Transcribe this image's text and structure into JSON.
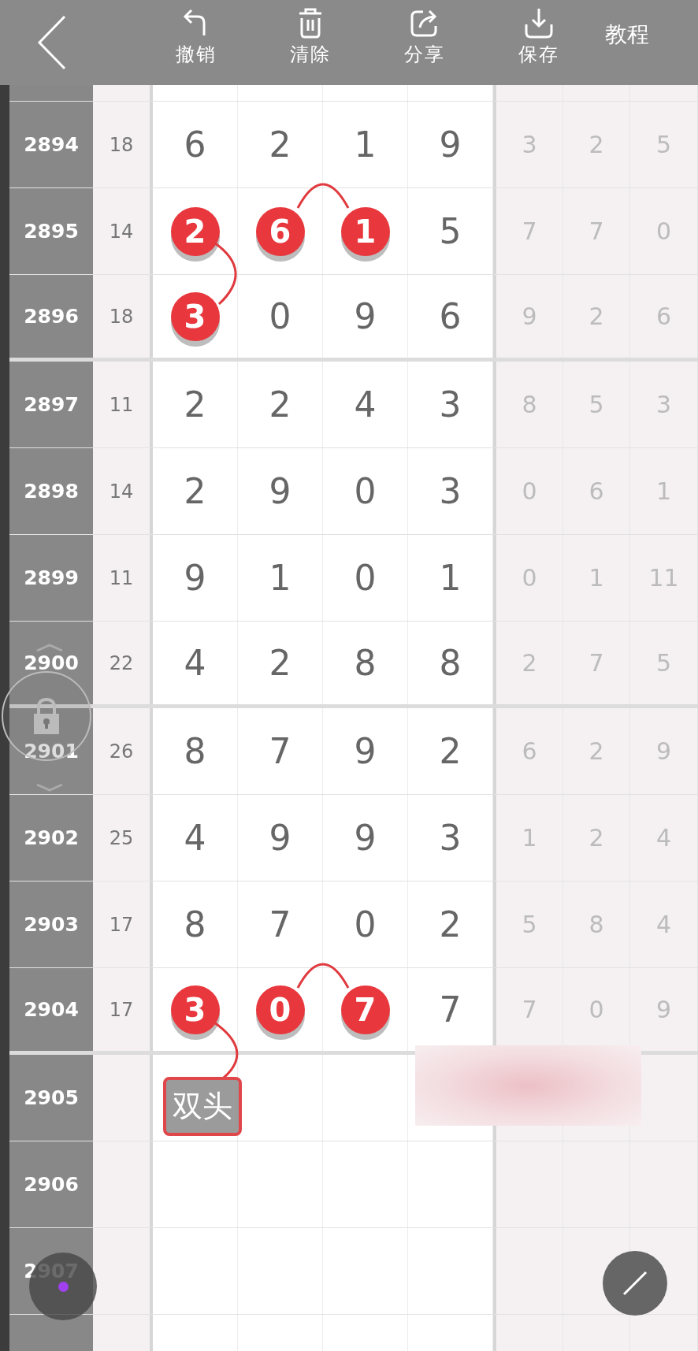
{
  "toolbar": {
    "actions": [
      "撤销",
      "清除",
      "分享",
      "保存"
    ],
    "tutorial": "教程"
  },
  "rows": [
    {
      "issue": "2894",
      "sum": "18",
      "main": [
        {
          "kind": "digit",
          "text": "6"
        },
        {
          "kind": "digit",
          "text": "2"
        },
        {
          "kind": "digit",
          "text": "1"
        },
        {
          "kind": "digit",
          "text": "9"
        }
      ],
      "side": [
        "3",
        "2",
        "5"
      ],
      "group_end": false
    },
    {
      "issue": "2895",
      "sum": "14",
      "main": [
        {
          "kind": "ball",
          "text": "2",
          "arc_to_next": false,
          "drop_line": true
        },
        {
          "kind": "ball",
          "text": "6",
          "arc_to_next": true,
          "drop_line": false
        },
        {
          "kind": "ball",
          "text": "1",
          "arc_to_next": false,
          "drop_line": false
        },
        {
          "kind": "digit",
          "text": "5"
        }
      ],
      "side": [
        "7",
        "7",
        "0"
      ],
      "group_end": false
    },
    {
      "issue": "2896",
      "sum": "18",
      "main": [
        {
          "kind": "ball",
          "text": "3",
          "arc_to_next": false,
          "drop_line": false
        },
        {
          "kind": "digit",
          "text": "0"
        },
        {
          "kind": "digit",
          "text": "9"
        },
        {
          "kind": "digit",
          "text": "6"
        }
      ],
      "side": [
        "9",
        "2",
        "6"
      ],
      "group_end": true
    },
    {
      "issue": "2897",
      "sum": "11",
      "main": [
        {
          "kind": "digit",
          "text": "2"
        },
        {
          "kind": "digit",
          "text": "2"
        },
        {
          "kind": "digit",
          "text": "4"
        },
        {
          "kind": "digit",
          "text": "3"
        }
      ],
      "side": [
        "8",
        "5",
        "3"
      ],
      "group_end": false
    },
    {
      "issue": "2898",
      "sum": "14",
      "main": [
        {
          "kind": "digit",
          "text": "2"
        },
        {
          "kind": "digit",
          "text": "9"
        },
        {
          "kind": "digit",
          "text": "0"
        },
        {
          "kind": "digit",
          "text": "3"
        }
      ],
      "side": [
        "0",
        "6",
        "1"
      ],
      "group_end": false
    },
    {
      "issue": "2899",
      "sum": "11",
      "main": [
        {
          "kind": "digit",
          "text": "9"
        },
        {
          "kind": "digit",
          "text": "1"
        },
        {
          "kind": "digit",
          "text": "0"
        },
        {
          "kind": "digit",
          "text": "1"
        }
      ],
      "side": [
        "0",
        "1",
        "11"
      ],
      "group_end": false
    },
    {
      "issue": "2900",
      "sum": "22",
      "main": [
        {
          "kind": "digit",
          "text": "4"
        },
        {
          "kind": "digit",
          "text": "2"
        },
        {
          "kind": "digit",
          "text": "8"
        },
        {
          "kind": "digit",
          "text": "8"
        }
      ],
      "side": [
        "2",
        "7",
        "5"
      ],
      "group_end": true
    },
    {
      "issue": "2901",
      "sum": "26",
      "main": [
        {
          "kind": "digit",
          "text": "8"
        },
        {
          "kind": "digit",
          "text": "7"
        },
        {
          "kind": "digit",
          "text": "9"
        },
        {
          "kind": "digit",
          "text": "2"
        }
      ],
      "side": [
        "6",
        "2",
        "9"
      ],
      "group_end": false
    },
    {
      "issue": "2902",
      "sum": "25",
      "main": [
        {
          "kind": "digit",
          "text": "4"
        },
        {
          "kind": "digit",
          "text": "9"
        },
        {
          "kind": "digit",
          "text": "9"
        },
        {
          "kind": "digit",
          "text": "3"
        }
      ],
      "side": [
        "1",
        "2",
        "4"
      ],
      "group_end": false
    },
    {
      "issue": "2903",
      "sum": "17",
      "main": [
        {
          "kind": "digit",
          "text": "8"
        },
        {
          "kind": "digit",
          "text": "7"
        },
        {
          "kind": "digit",
          "text": "0"
        },
        {
          "kind": "digit",
          "text": "2"
        }
      ],
      "side": [
        "5",
        "8",
        "4"
      ],
      "group_end": false
    },
    {
      "issue": "2904",
      "sum": "17",
      "main": [
        {
          "kind": "ball",
          "text": "3",
          "arc_to_next": false,
          "drop_line": true
        },
        {
          "kind": "ball",
          "text": "0",
          "arc_to_next": true,
          "drop_line": false
        },
        {
          "kind": "ball",
          "text": "7",
          "arc_to_next": false,
          "drop_line": false
        },
        {
          "kind": "digit",
          "text": "7"
        }
      ],
      "side": [
        "7",
        "0",
        "9"
      ],
      "group_end": true
    },
    {
      "issue": "2905",
      "main": [
        {
          "kind": "tag",
          "text": "双头"
        }
      ],
      "group_end": false
    },
    {
      "issue": "2906",
      "main": [],
      "group_end": false
    },
    {
      "issue": "2907",
      "main": [],
      "group_end": false
    }
  ]
}
